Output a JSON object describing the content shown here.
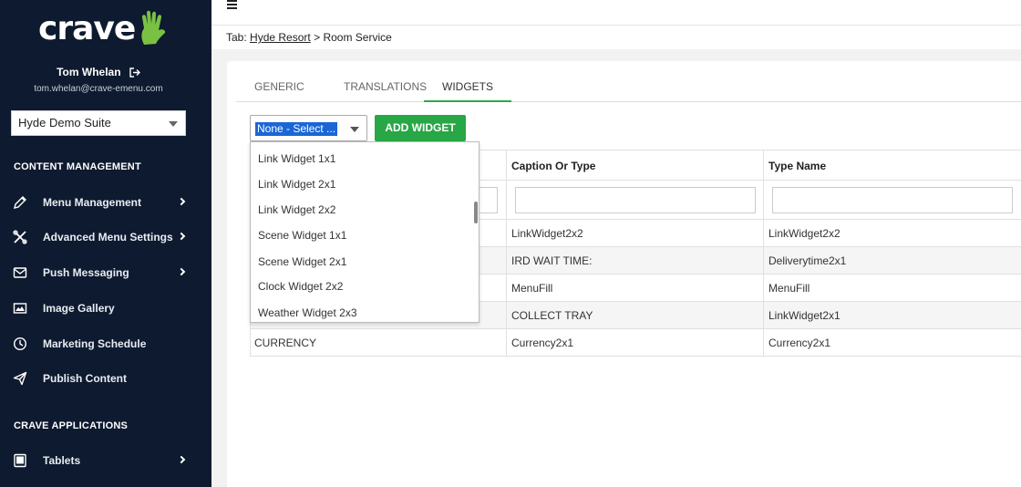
{
  "sidebar": {
    "logo": "crave",
    "user": {
      "name": "Tom Whelan",
      "email": "tom.whelan@crave-emenu.com"
    },
    "suite_select": "Hyde Demo Suite",
    "sections": {
      "content": "CONTENT MANAGEMENT",
      "apps": "CRAVE APPLICATIONS"
    },
    "items": [
      {
        "label": "Menu Management",
        "icon": "pencil-icon",
        "has_chevron": true
      },
      {
        "label": "Advanced Menu Settings",
        "icon": "tools-icon",
        "has_chevron": true
      },
      {
        "label": "Push Messaging",
        "icon": "envelope-icon",
        "has_chevron": true
      },
      {
        "label": "Image Gallery",
        "icon": "image-icon",
        "has_chevron": false
      },
      {
        "label": "Marketing Schedule",
        "icon": "clock-icon",
        "has_chevron": false
      },
      {
        "label": "Publish Content",
        "icon": "paper-plane-icon",
        "has_chevron": false
      }
    ],
    "app_items": [
      {
        "label": "Tablets",
        "icon": "tablet-icon",
        "has_chevron": true
      }
    ],
    "colors": {
      "background": "#0e1a2f",
      "accent": "#7ac143"
    }
  },
  "breadcrumb": {
    "prefix": "Tab:",
    "link": "Hyde Resort",
    "separator": ">",
    "current": "Room Service"
  },
  "tabs": [
    {
      "label": "GENERIC",
      "active": false
    },
    {
      "label": "TRANSLATIONS",
      "active": false
    },
    {
      "label": "WIDGETS",
      "active": true
    }
  ],
  "widget_select": {
    "value": "None - Select ...",
    "options": [
      "Link Widget 1x1",
      "Link Widget 2x1",
      "Link Widget 2x2",
      "Scene Widget 1x1",
      "Scene Widget 2x1",
      "Clock Widget 2x2",
      "Weather Widget 2x3"
    ]
  },
  "add_widget_label": "ADD WIDGET",
  "table": {
    "columns": [
      "",
      "Caption Or Type",
      "Type Name"
    ],
    "rows": [
      [
        "",
        "LinkWidget2x2",
        "LinkWidget2x2"
      ],
      [
        "",
        "IRD WAIT TIME:",
        "Deliverytime2x1"
      ],
      [
        "",
        "MenuFill",
        "MenuFill"
      ],
      [
        "",
        "COLLECT TRAY",
        "LinkWidget2x1"
      ],
      [
        "CURRENCY",
        "Currency2x1",
        "Currency2x1"
      ]
    ]
  },
  "colors": {
    "primary_green": "#27a745",
    "selection_blue": "#1a66d6"
  }
}
